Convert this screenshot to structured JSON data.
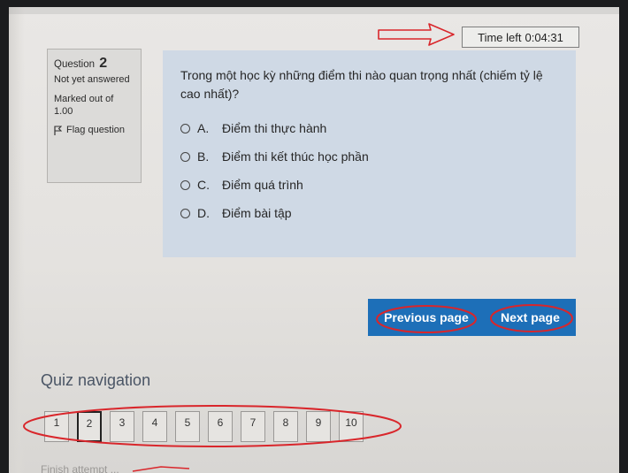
{
  "timer": {
    "label": "Time left",
    "value": "0:04:31"
  },
  "question_info": {
    "question_label": "Question",
    "question_number": "2",
    "state": "Not yet answered",
    "grade": "Marked out of 1.00",
    "flag_label": "Flag question"
  },
  "question": {
    "text": "Trong một học kỳ những điểm thi nào quan trọng nhất (chiếm tỷ lệ cao nhất)?",
    "answers": [
      {
        "letter": "A.",
        "text": "Điểm thi thực hành"
      },
      {
        "letter": "B.",
        "text": "Điểm thi kết thúc học phần"
      },
      {
        "letter": "C.",
        "text": "Điểm quá trình"
      },
      {
        "letter": "D.",
        "text": "Điểm bài tập"
      }
    ]
  },
  "navigation": {
    "previous_label": "Previous page",
    "next_label": "Next page"
  },
  "quiz_navigation": {
    "title": "Quiz navigation",
    "current": "2",
    "questions": [
      "1",
      "2",
      "3",
      "4",
      "5",
      "6",
      "7",
      "8",
      "9",
      "10"
    ],
    "finish_label": "Finish attempt ..."
  },
  "colors": {
    "question_background": "#cfd9e5",
    "nav_button_background": "#1d6fb8",
    "annotation_red": "#d9262b"
  }
}
